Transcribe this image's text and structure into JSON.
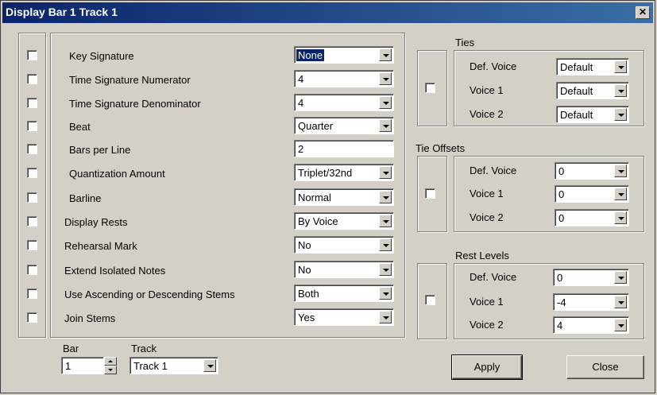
{
  "window": {
    "title": "Display Bar 1 Track 1",
    "close_glyph": "✕"
  },
  "properties": [
    {
      "label": "Key Signature",
      "value": "None",
      "kind": "combo",
      "selected": true
    },
    {
      "label": "Time Signature Numerator",
      "value": "4",
      "kind": "combo"
    },
    {
      "label": "Time Signature Denominator",
      "value": "4",
      "kind": "combo"
    },
    {
      "label": "Beat",
      "value": "Quarter",
      "kind": "combo"
    },
    {
      "label": "Bars per Line",
      "value": "2",
      "kind": "edit"
    },
    {
      "label": "Quantization Amount",
      "value": "Triplet/32nd",
      "kind": "combo"
    },
    {
      "label": "Barline",
      "value": "Normal",
      "kind": "combo"
    },
    {
      "label": "Display Rests",
      "value": "By Voice",
      "kind": "combo"
    },
    {
      "label": "Rehearsal Mark",
      "value": "No",
      "kind": "combo"
    },
    {
      "label": "Extend Isolated Notes",
      "value": "No",
      "kind": "combo"
    },
    {
      "label": "Use Ascending or Descending Stems",
      "value": "Both",
      "kind": "combo"
    },
    {
      "label": "Join Stems",
      "value": "Yes",
      "kind": "combo"
    }
  ],
  "ties": {
    "title": "Ties",
    "rows": [
      {
        "label": "Def. Voice",
        "value": "Default"
      },
      {
        "label": "Voice 1",
        "value": "Default"
      },
      {
        "label": "Voice 2",
        "value": "Default"
      }
    ]
  },
  "tie_offsets": {
    "title": "Tie Offsets",
    "rows": [
      {
        "label": "Def. Voice",
        "value": "0"
      },
      {
        "label": "Voice 1",
        "value": "0"
      },
      {
        "label": "Voice 2",
        "value": "0"
      }
    ]
  },
  "rest_levels": {
    "title": "Rest Levels",
    "rows": [
      {
        "label": "Def. Voice",
        "value": "0"
      },
      {
        "label": "Voice 1",
        "value": "-4"
      },
      {
        "label": "Voice 2",
        "value": "4"
      }
    ]
  },
  "footer": {
    "bar_label": "Bar",
    "bar_value": "1",
    "track_label": "Track",
    "track_value": "Track 1",
    "apply_label": "Apply",
    "close_label": "Close"
  }
}
